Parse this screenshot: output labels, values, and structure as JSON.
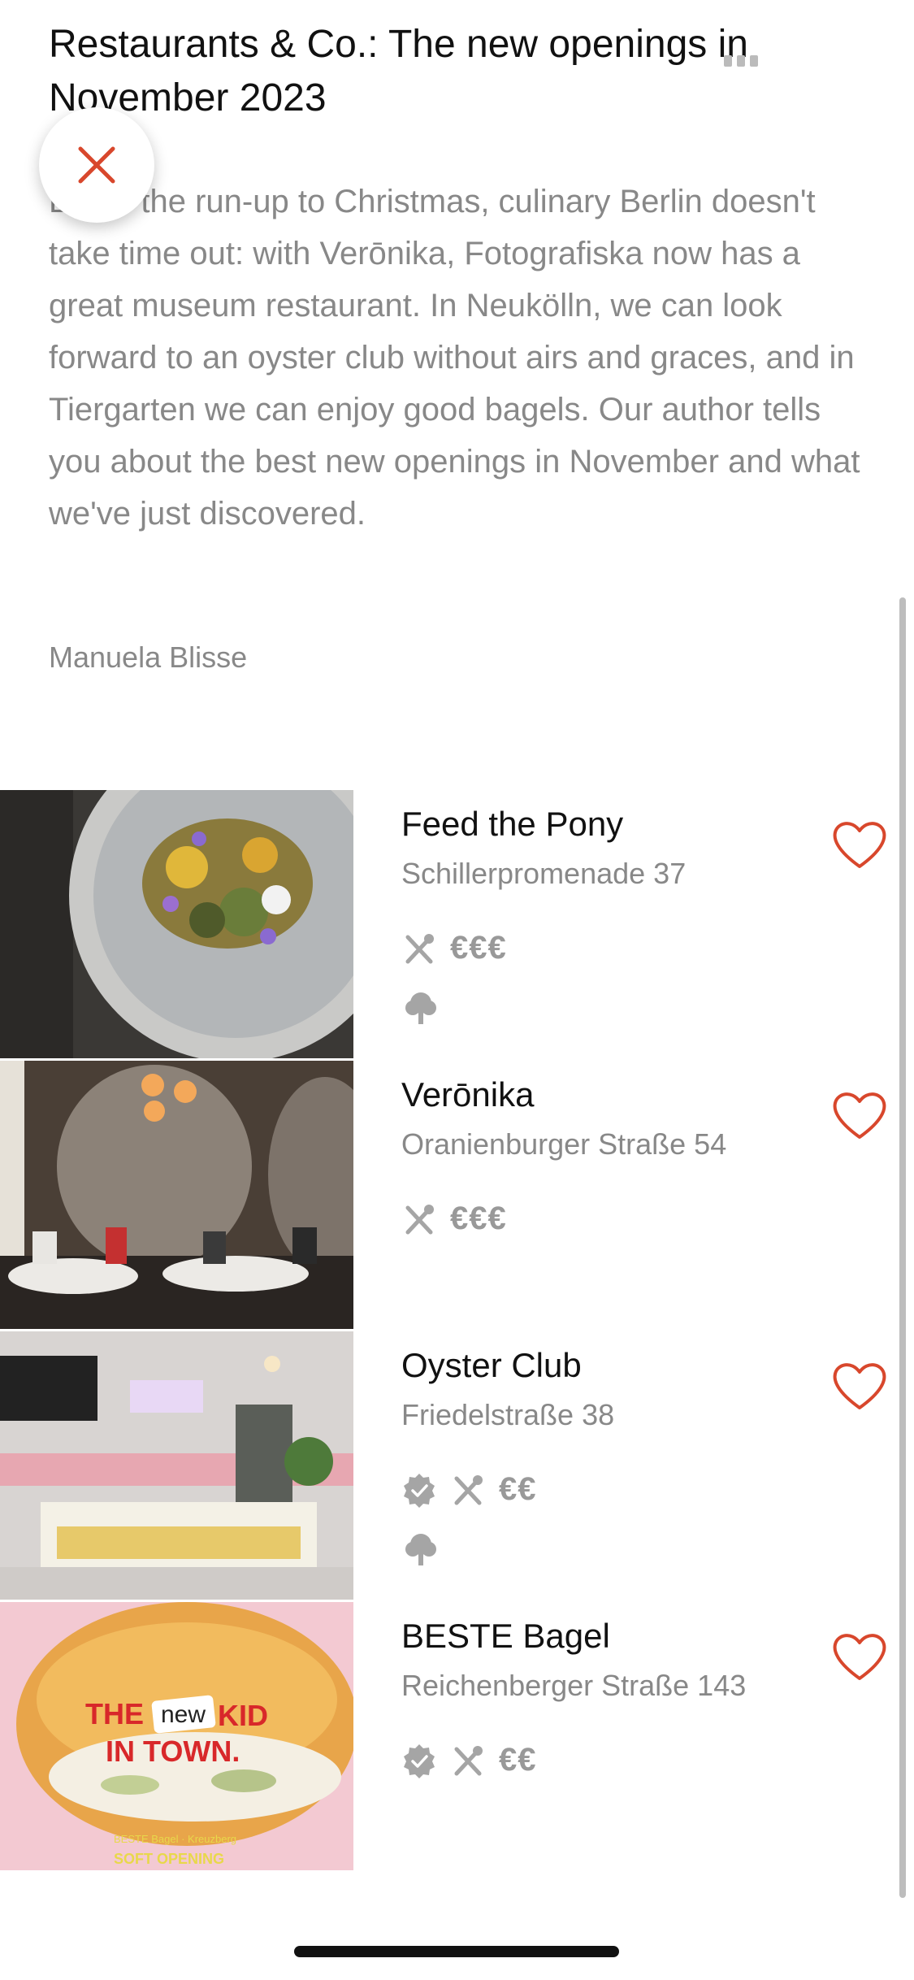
{
  "article": {
    "title": "Restaurants & Co.: The new openings in November 2023",
    "intro": "Berlin the run-up to Christmas, culinary Berlin doesn't take time out: with Verōnika, Fotografiska now has a great museum restaurant. In Neukölln, we can look forward to an oyster club without airs and graces, and in Tiergarten we can enjoy good bagels. Our author tells you about the best new openings in November and what we've just discovered.",
    "author": "Manuela Blisse"
  },
  "colors": {
    "accent": "#d8472c",
    "text_primary": "#111111",
    "text_secondary": "#888888",
    "icon_gray": "#a5a5a5"
  },
  "restaurants": [
    {
      "name": "Feed the Pony",
      "address": "Schillerpromenade 37",
      "price": "€€€",
      "icons": [
        "cutlery-icon",
        "tree-icon"
      ],
      "image": "plated-dish-photo"
    },
    {
      "name": "Verōnika",
      "address": "Oranienburger Straße 54",
      "price": "€€€",
      "icons": [
        "cutlery-icon"
      ],
      "image": "dining-room-photo"
    },
    {
      "name": "Oyster Club",
      "address": "Friedelstraße 38",
      "price": "€€",
      "icons": [
        "verified-badge-icon",
        "cutlery-icon",
        "tree-icon"
      ],
      "image": "oyster-bar-photo"
    },
    {
      "name": "BESTE Bagel",
      "address": "Reichenberger Straße  143",
      "price": "€€",
      "icons": [
        "verified-badge-icon",
        "cutlery-icon"
      ],
      "image": "bagel-poster-photo"
    }
  ],
  "bagel_poster": {
    "headline_1": "THE",
    "headline_new": "new",
    "headline_2": "KID",
    "headline_3": "IN TOWN.",
    "small_1": "BESTE Bagel · Kreuzberg",
    "small_2": "SOFT OPENING"
  }
}
